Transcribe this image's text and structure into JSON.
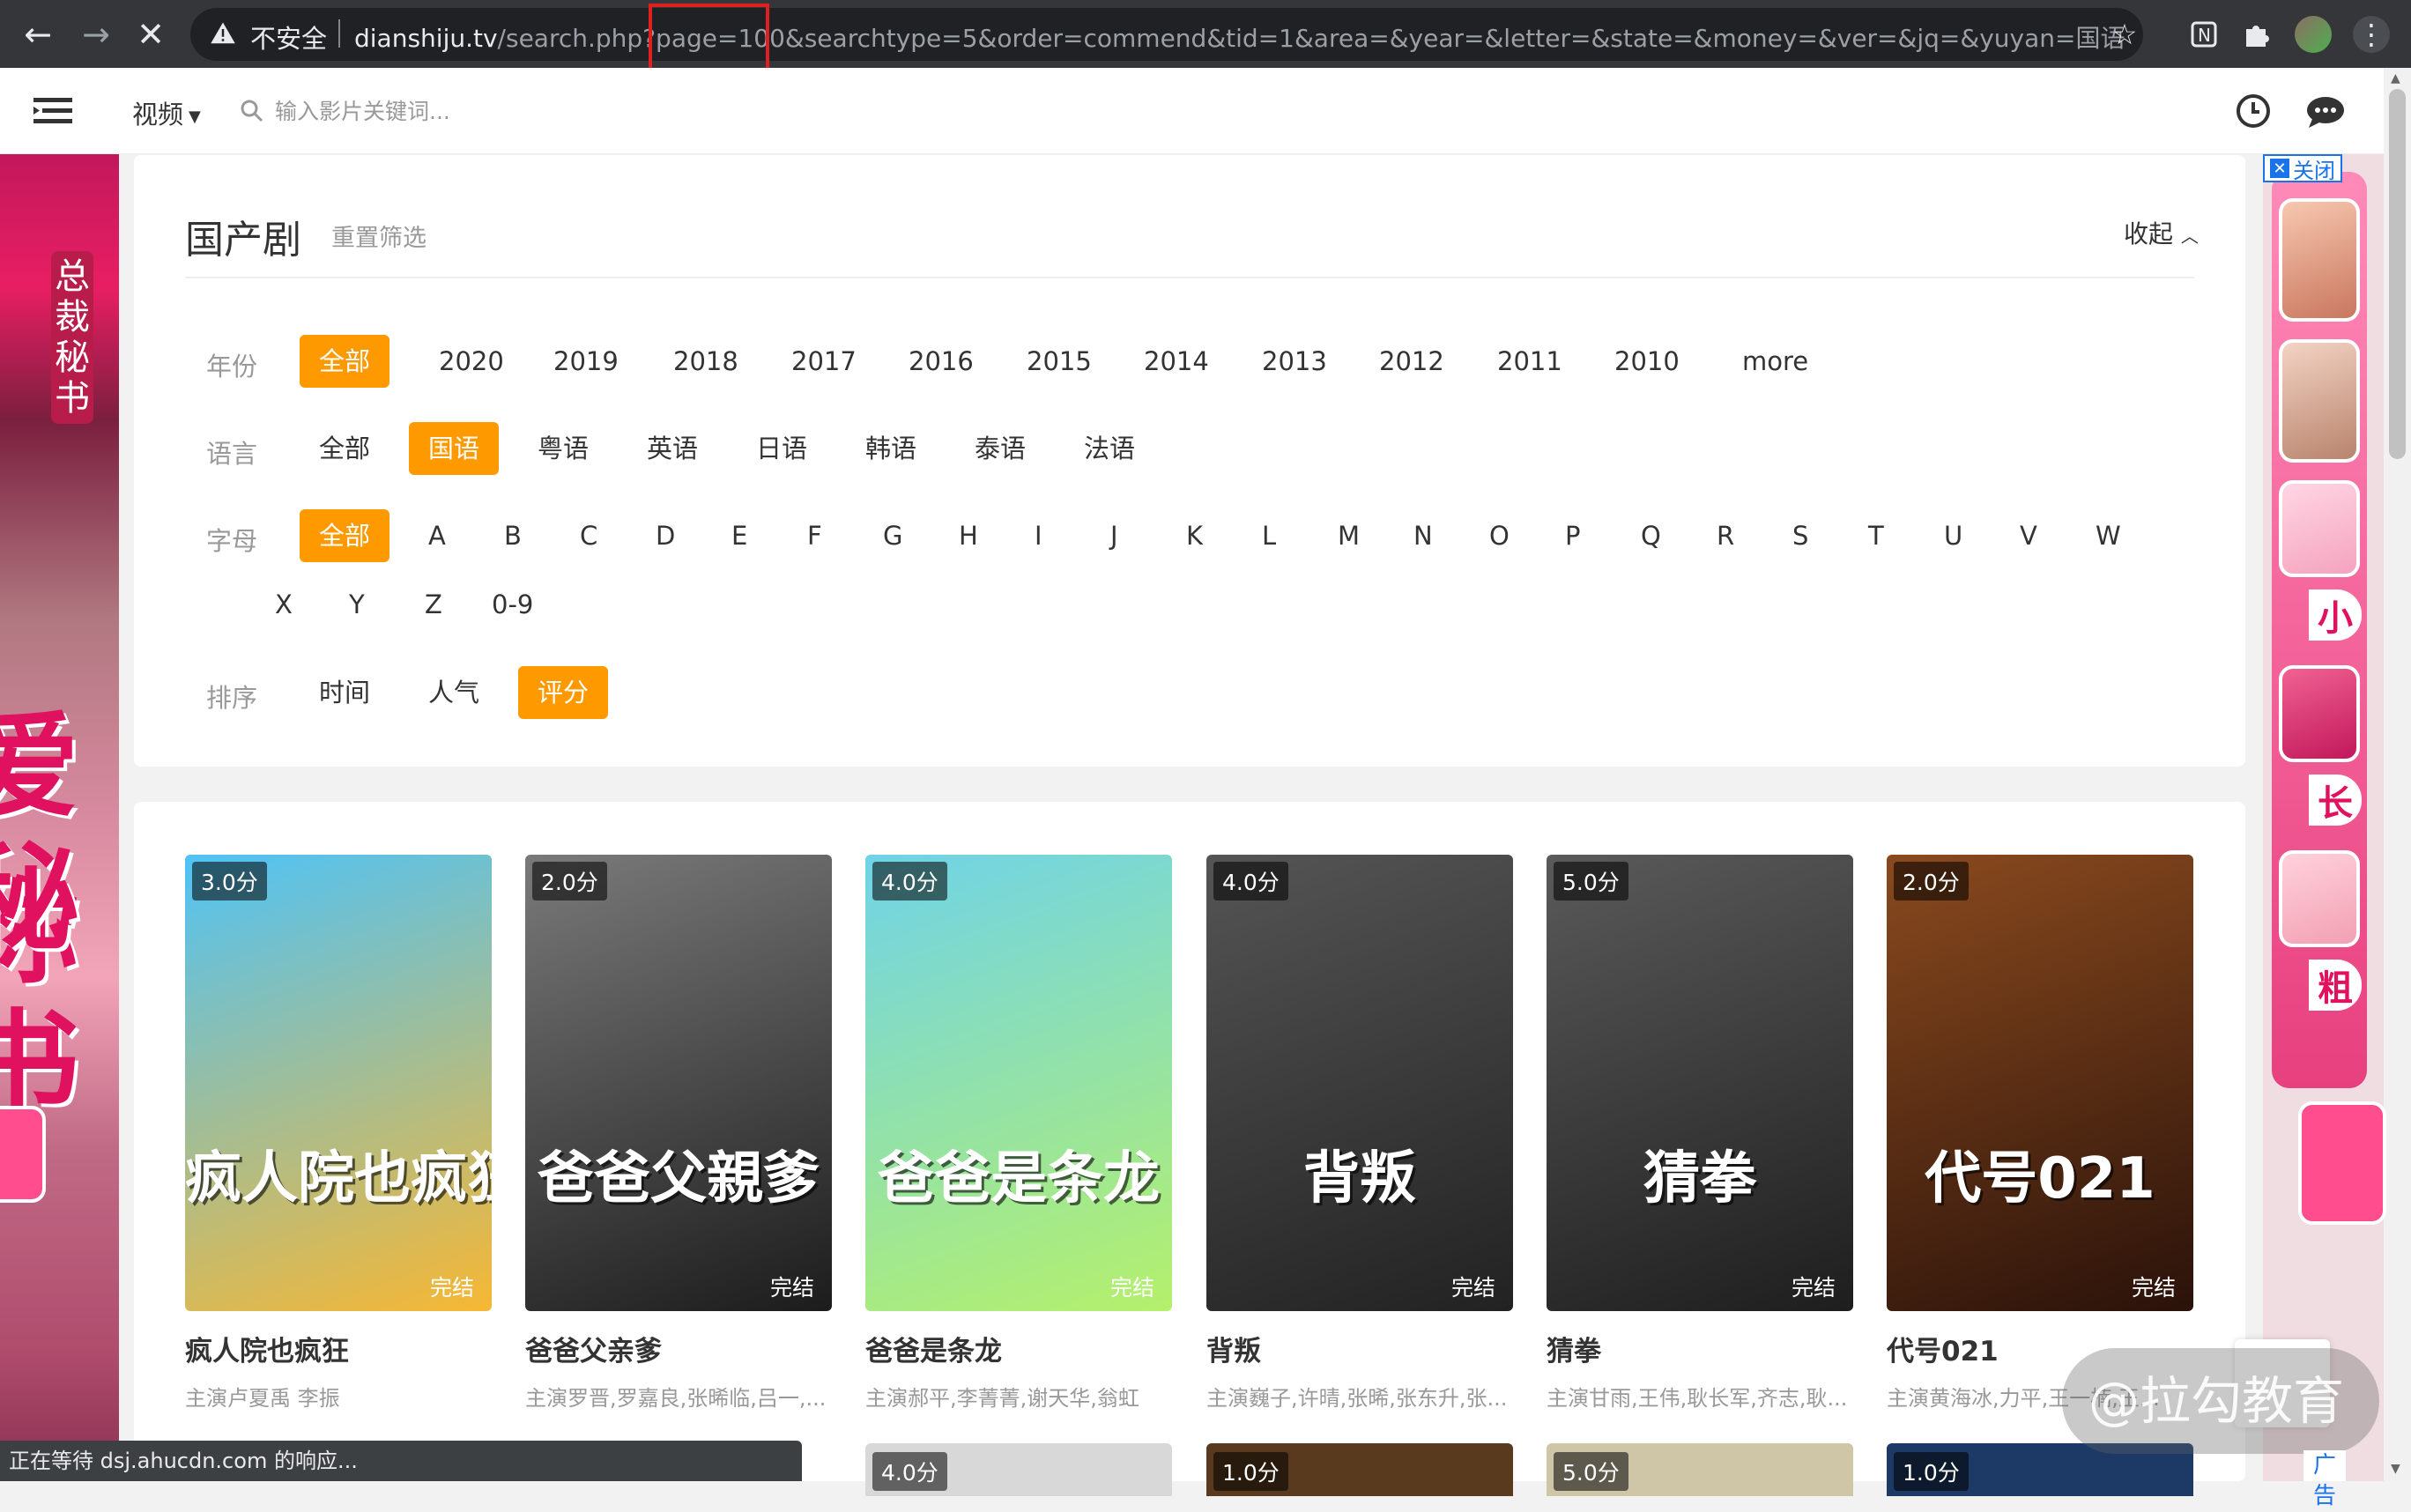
{
  "browser": {
    "insecure_label": "不安全",
    "url_host": "dianshiju.tv",
    "url_path": "/search.php?page=100&searchtype=5&order=commend&tid=1&area=&year=&letter=&state=&money=&ver=&jq=&yuyan=国语",
    "status_text": "正在等待 dsj.ahucdn.com 的响应...",
    "highlight_color": "#e02020"
  },
  "site": {
    "channel_label": "视频",
    "search_placeholder": "输入影片关键词..."
  },
  "ads": {
    "close_label": "关闭",
    "ad_label": "广告",
    "left_title": "总裁秘书",
    "left_big_1": "爱你",
    "left_big_2": "秘书",
    "right_chars": [
      "小",
      "长",
      "粗"
    ]
  },
  "filter": {
    "title": "国产剧",
    "reset_label": "重置筛选",
    "collapse_label": "收起",
    "accent_color": "#ff9900",
    "rows": [
      {
        "label": "年份",
        "options": [
          "全部",
          "2020",
          "2019",
          "2018",
          "2017",
          "2016",
          "2015",
          "2014",
          "2013",
          "2012",
          "2011",
          "2010",
          "more"
        ],
        "active": 0
      },
      {
        "label": "语言",
        "options": [
          "全部",
          "国语",
          "粤语",
          "英语",
          "日语",
          "韩语",
          "泰语",
          "法语"
        ],
        "active": 1
      },
      {
        "label": "字母",
        "options": [
          "全部",
          "A",
          "B",
          "C",
          "D",
          "E",
          "F",
          "G",
          "H",
          "I",
          "J",
          "K",
          "L",
          "M",
          "N",
          "O",
          "P",
          "Q",
          "R",
          "S",
          "T",
          "U",
          "V",
          "W"
        ],
        "active": 0
      },
      {
        "label": "",
        "options": [
          "X",
          "Y",
          "Z",
          "0-9"
        ],
        "active": -1
      },
      {
        "label": "排序",
        "options": [
          "时间",
          "人气",
          "评分"
        ],
        "active": 2
      }
    ]
  },
  "results": [
    {
      "name": "疯人院也疯狂",
      "cast": "主演卢夏禹 李振",
      "score": "3.0分",
      "status": "完结",
      "poster_text": "疯人院也疯狂",
      "colors": [
        "#4fc3f7",
        "#f7b733"
      ]
    },
    {
      "name": "爸爸父亲爹",
      "cast": "主演罗晋,罗嘉良,张晞临,吕一,...",
      "score": "2.0分",
      "status": "完结",
      "poster_text": "爸爸父親爹",
      "colors": [
        "#7a7a7a",
        "#1c1c1c"
      ]
    },
    {
      "name": "爸爸是条龙",
      "cast": "主演郝平,李菁菁,谢天华,翁虹",
      "score": "4.0分",
      "status": "完结",
      "poster_text": "爸爸是条龙",
      "colors": [
        "#6fd3e8",
        "#b5f06b"
      ]
    },
    {
      "name": "背叛",
      "cast": "主演巍子,许晴,张晞,张东升,张...",
      "score": "4.0分",
      "status": "完结",
      "poster_text": "背叛",
      "colors": [
        "#555555",
        "#222222"
      ]
    },
    {
      "name": "猜拳",
      "cast": "主演甘雨,王伟,耿长军,齐志,耿...",
      "score": "5.0分",
      "status": "完结",
      "poster_text": "猜拳",
      "colors": [
        "#5a5a5a",
        "#1e1e1e"
      ]
    },
    {
      "name": "代号021",
      "cast": "主演黄海冰,力平,王一楠,王...",
      "score": "2.0分",
      "status": "完结",
      "poster_text": "代号021",
      "colors": [
        "#8a4a1e",
        "#2a120a"
      ]
    }
  ],
  "results_row2_scores": [
    "4.0分",
    "1.0分",
    "5.0分",
    "1.0分"
  ],
  "watermark": "@拉勾教育"
}
